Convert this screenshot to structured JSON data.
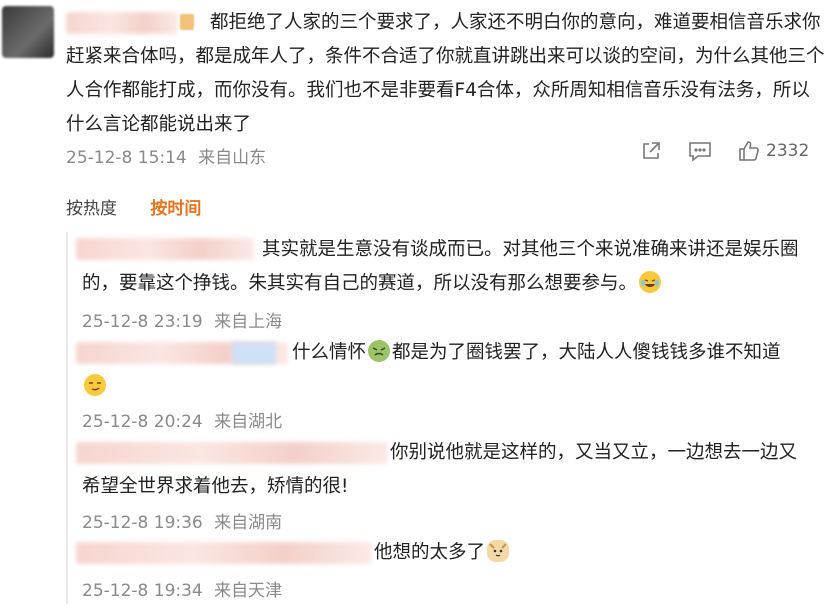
{
  "main_comment": {
    "text": "都拒绝了人家的三个要求了，人家还不明白你的意向，难道要相信音乐求你赶紧来合体吗，都是成年人了，条件不合适了你就直讲跳出来可以谈的空间，为什么其他三个人合作都能打成，而你没有。我们也不是非要看F4合体，众所周知相信音乐没有法务，所以什么言论都能说出来了",
    "timestamp": "25-12-8 15:14",
    "location": "来自山东",
    "like_count": "2332"
  },
  "sort_tabs": {
    "hot": "按热度",
    "time": "按时间"
  },
  "replies": [
    {
      "text": "其实就是生意没有谈成而已。对其他三个来说准确来讲还是娱乐圈的，要靠这个挣钱。朱其实有自己的赛道，所以没有那么想要参与。",
      "emoji": "laughing-tears-emoji",
      "timestamp": "25-12-8 23:19",
      "location": "来自上海"
    },
    {
      "text": "什么情怀",
      "emoji_mid": "disgusted-emoji",
      "text2": "都是为了圈钱罢了，大陆人人傻钱钱多谁不知道",
      "emoji": "smirk-emoji",
      "timestamp": "25-12-8 20:24",
      "location": "来自湖北"
    },
    {
      "text": "你别说他就是这样的，又当又立，一边想去一边又希望全世界求着他去，矫情的很!",
      "timestamp": "25-12-8 19:36",
      "location": "来自湖南"
    },
    {
      "text": "他想的太多了",
      "emoji": "doge-emoji",
      "timestamp": "25-12-8 19:34",
      "location": "来自天津"
    }
  ],
  "colors": {
    "accent": "#e8731c",
    "meta": "#8a8a8a",
    "text": "#222222"
  }
}
